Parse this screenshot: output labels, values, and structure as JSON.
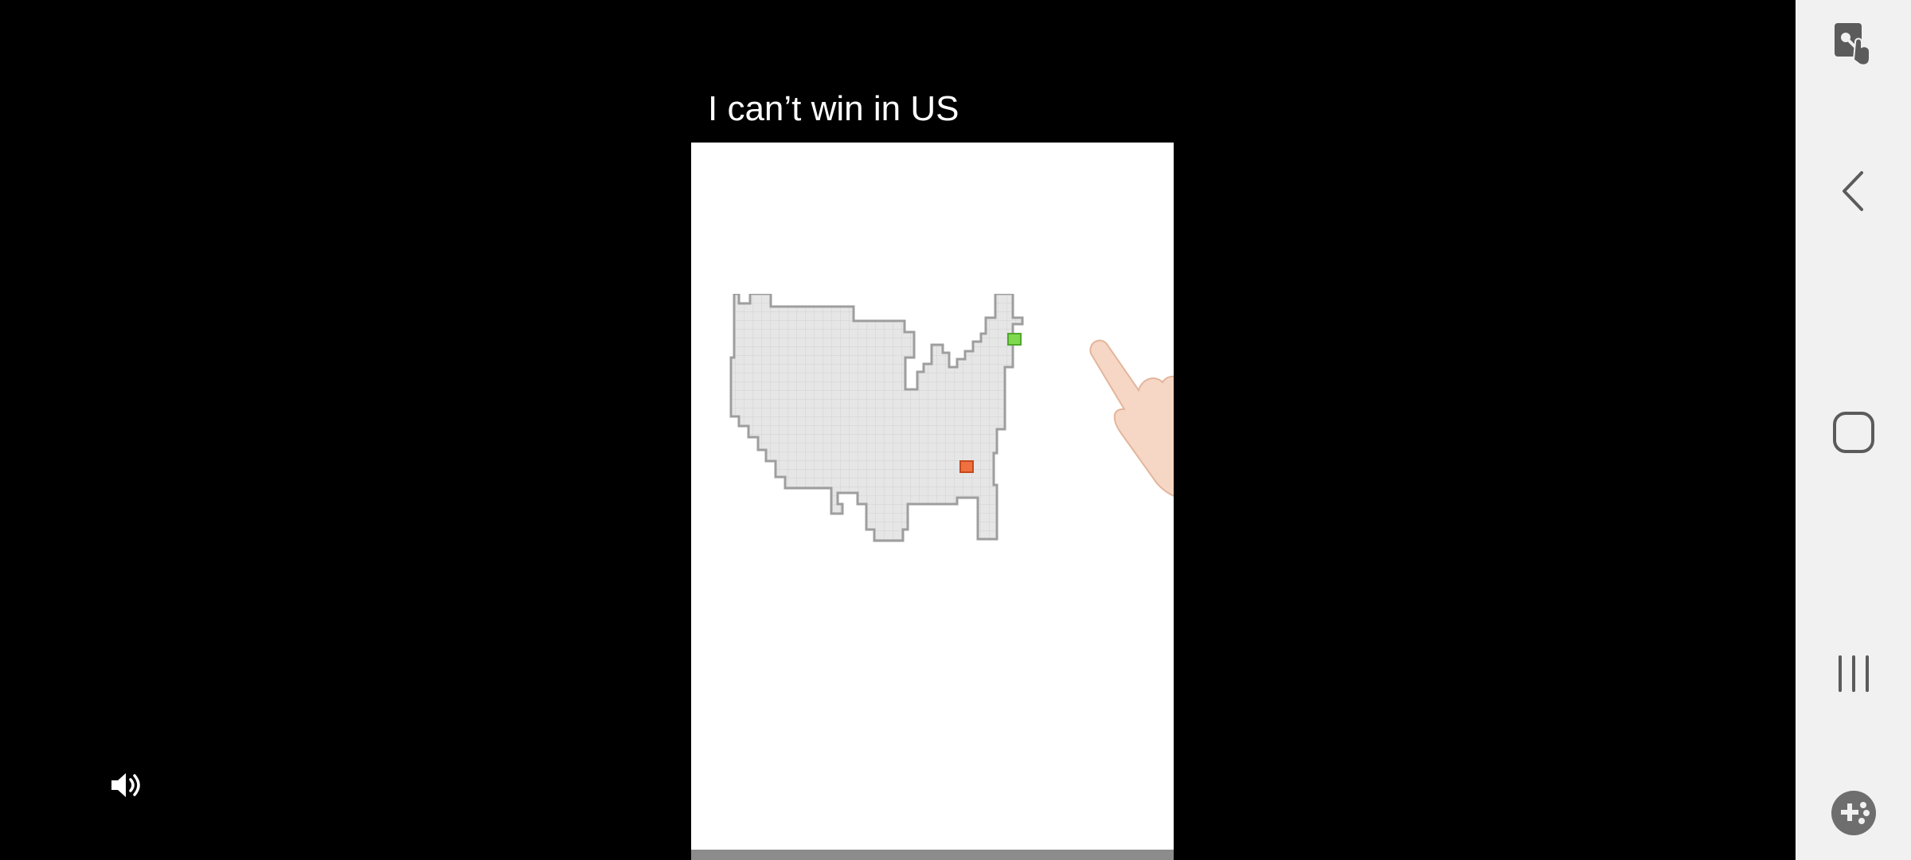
{
  "video": {
    "caption": "I can’t win in US"
  },
  "game": {
    "start_tile_color": "#7fd94f",
    "goal_tile_color": "#f07040",
    "board_color": "#e6e6e6"
  },
  "controls": {
    "volume_icon": "volume-icon"
  },
  "navbar": {
    "buttons": [
      {
        "icon": "touch-lock-icon"
      },
      {
        "icon": "back-icon"
      },
      {
        "icon": "home-icon"
      },
      {
        "icon": "recent-apps-icon"
      },
      {
        "icon": "game-tools-icon"
      }
    ]
  }
}
